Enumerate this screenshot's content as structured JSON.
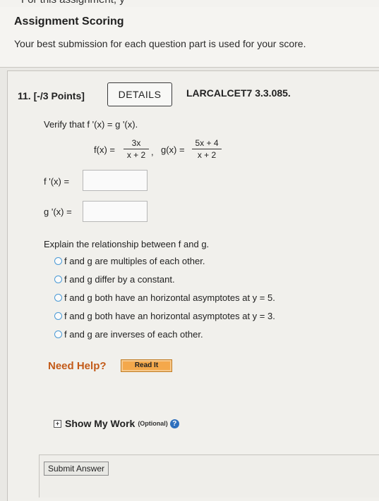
{
  "header": {
    "cut_text": "For this assignment, y",
    "title": "Assignment Scoring",
    "subtitle": "Your best submission for each question part is used for your score."
  },
  "question": {
    "number": "11. [-/3 Points]",
    "details_label": "DETAILS",
    "source": "LARCALCET7 3.3.085.",
    "prompt": "Verify that f '(x) = g '(x).",
    "f_lhs": "f(x) =",
    "f_num": "3x",
    "f_den": "x + 2",
    "g_lhs": "g(x) =",
    "g_num": "5x + 4",
    "g_den": "x + 2",
    "fprime_label": "f '(x) =",
    "gprime_label": "g '(x) =",
    "fprime_value": "",
    "gprime_value": "",
    "explain_prompt": "Explain the relationship between f and g.",
    "options": [
      "f and g are multiples of each other.",
      "f and g differ by a constant.",
      "f and g both have an horizontal asymptotes at y = 5.",
      "f and g both have an horizontal asymptotes at y = 3.",
      "f and g are inverses of each other."
    ]
  },
  "help": {
    "need_help": "Need Help?",
    "read_it": "Read It"
  },
  "show_work": {
    "plus": "+",
    "label": "Show My Work",
    "optional": "(Optional)",
    "help_glyph": "?"
  },
  "submit": {
    "label": "Submit Answer"
  },
  "icons": {
    "expand": "plus-box-icon",
    "help": "question-circle-icon"
  },
  "colors": {
    "need_help": "#c35a18",
    "read_it_bg": "#f4a84b",
    "help_icon": "#2e6fbd",
    "radio_border": "#4a9ad6"
  }
}
